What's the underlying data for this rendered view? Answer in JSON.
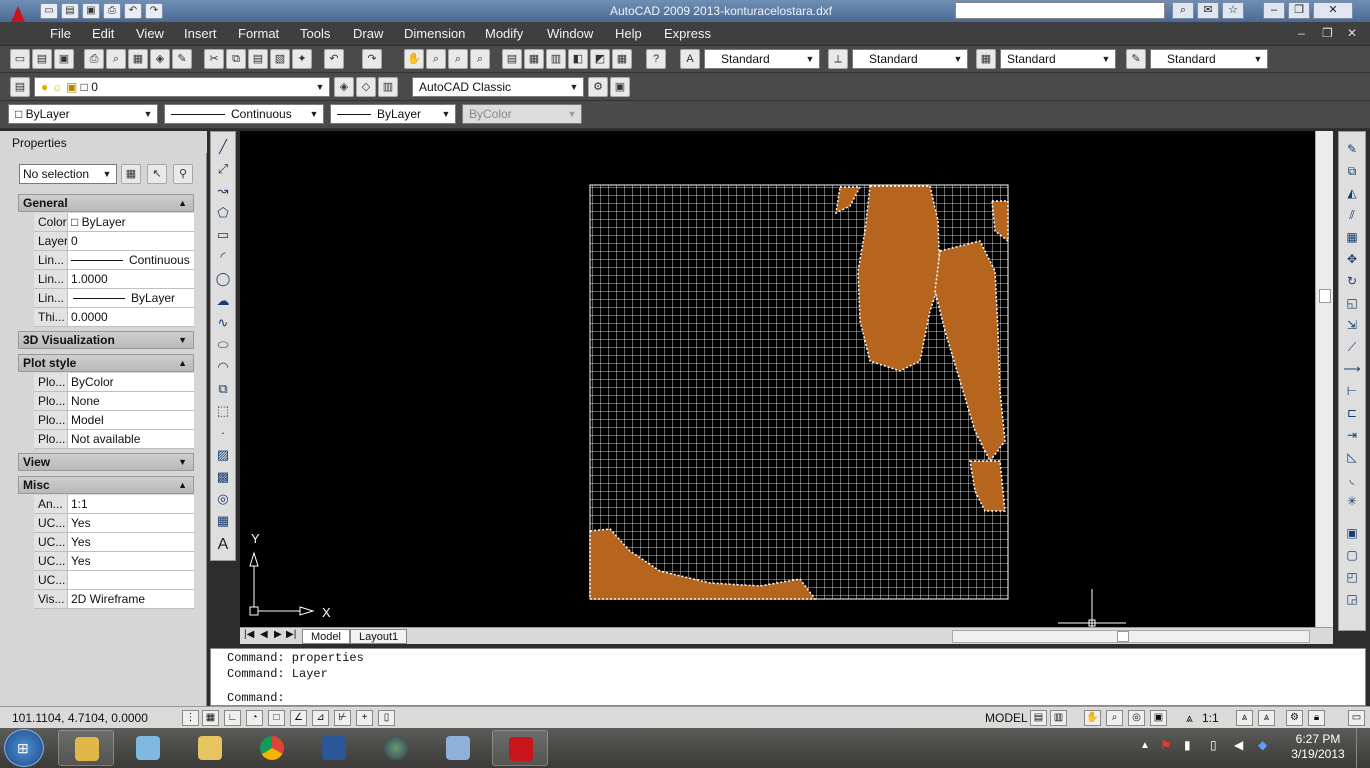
{
  "window": {
    "title": "AutoCAD 2009  2013-konturacelostara.dxf",
    "controls": [
      "minimize",
      "restore",
      "close"
    ]
  },
  "menu": {
    "items": [
      "File",
      "Edit",
      "View",
      "Insert",
      "Format",
      "Tools",
      "Draw",
      "Dimension",
      "Modify",
      "Window",
      "Help",
      "Express"
    ]
  },
  "toolbar_standard": {
    "text_style": "Standard",
    "dim_style": "Standard",
    "table_style": "Standard",
    "multileader_style": "Standard"
  },
  "toolbar_layers": {
    "layer": "0",
    "workspace": "AutoCAD Classic"
  },
  "toolbar_properties": {
    "color": "ByLayer",
    "linetype": "Continuous",
    "lineweight": "ByLayer",
    "plotstyle": "ByColor"
  },
  "properties": {
    "title": "Properties",
    "selection": "No selection",
    "general": {
      "label": "General",
      "rows": [
        {
          "key": "Color",
          "value": "ByLayer"
        },
        {
          "key": "Layer",
          "value": "0"
        },
        {
          "key": "Lin...",
          "value": "Continuous"
        },
        {
          "key": "Lin...",
          "value": "1.0000"
        },
        {
          "key": "Lin...",
          "value": "ByLayer"
        },
        {
          "key": "Thi...",
          "value": "0.0000"
        }
      ]
    },
    "viz3d": {
      "label": "3D Visualization"
    },
    "plotstyle": {
      "label": "Plot style",
      "rows": [
        {
          "key": "Plo...",
          "value": "ByColor"
        },
        {
          "key": "Plo...",
          "value": "None"
        },
        {
          "key": "Plo...",
          "value": "Model"
        },
        {
          "key": "Plo...",
          "value": "Not available"
        }
      ]
    },
    "view": {
      "label": "View"
    },
    "misc": {
      "label": "Misc",
      "rows": [
        {
          "key": "An...",
          "value": "1:1"
        },
        {
          "key": "UC...",
          "value": "Yes"
        },
        {
          "key": "UC...",
          "value": "Yes"
        },
        {
          "key": "UC...",
          "value": "Yes"
        },
        {
          "key": "UC...",
          "value": ""
        },
        {
          "key": "Vis...",
          "value": "2D Wireframe"
        }
      ]
    }
  },
  "canvas": {
    "ucs_x": "X",
    "ucs_y": "Y",
    "grid_color": "#ffffff",
    "contour_color": "#b5651d"
  },
  "layout_tabs": [
    "Model",
    "Layout1"
  ],
  "command": {
    "history": [
      "Command: properties",
      "Command: Layer"
    ],
    "prompt": "Command:"
  },
  "status": {
    "coords": "101.1104, 4.7104, 0.0000",
    "model": "MODEL",
    "annotation_scale": "1:1"
  },
  "taskbar": {
    "time": "6:27 PM",
    "date": "3/19/2013"
  }
}
